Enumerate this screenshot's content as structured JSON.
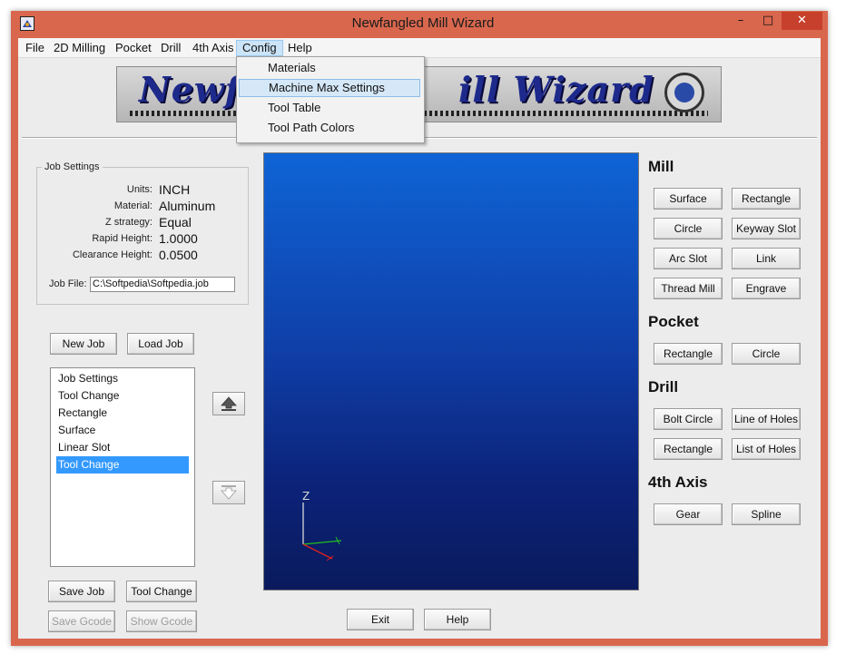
{
  "window": {
    "title": "Newfangled Mill Wizard",
    "minimize_label": "–",
    "maximize_label": "□",
    "close_label": "✕"
  },
  "menubar": {
    "items": [
      "File",
      "2D Milling",
      "Pocket",
      "Drill",
      "4th Axis",
      "Config",
      "Help"
    ],
    "active": "Config"
  },
  "config_menu": {
    "items": [
      "Materials",
      "Machine Max Settings",
      "Tool Table",
      "Tool Path Colors"
    ],
    "highlighted": "Machine Max Settings"
  },
  "banner": {
    "text_left": "Newf",
    "text_right": "ill Wizard"
  },
  "job_settings": {
    "legend": "Job Settings",
    "rows": [
      {
        "label": "Units:",
        "value": "INCH"
      },
      {
        "label": "Material:",
        "value": "Aluminum"
      },
      {
        "label": "Z strategy:",
        "value": "Equal"
      },
      {
        "label": "Rapid Height:",
        "value": "1.0000"
      },
      {
        "label": "Clearance Height:",
        "value": "0.0500"
      }
    ],
    "job_file_label": "Job File:",
    "job_file_value": "C:\\Softpedia\\Softpedia.job"
  },
  "job_buttons": {
    "new_job": "New Job",
    "load_job": "Load Job",
    "save_job": "Save Job",
    "tool_change": "Tool Change",
    "save_gcode": "Save Gcode",
    "show_gcode": "Show Gcode"
  },
  "operations": {
    "items": [
      "Job Settings",
      "Tool Change",
      "Rectangle",
      "Surface",
      "Linear Slot",
      "Tool Change"
    ],
    "selected_index": 5
  },
  "viewport": {
    "axis_label": "Z",
    "colors": {
      "x_axis": "#e02020",
      "y_axis": "#20c020",
      "z_axis": "#d8d8d8"
    }
  },
  "bottom_buttons": {
    "exit": "Exit",
    "help": "Help"
  },
  "palette": {
    "mill": {
      "title": "Mill",
      "buttons": [
        "Surface",
        "Rectangle",
        "Circle",
        "Keyway Slot",
        "Arc Slot",
        "Link",
        "Thread Mill",
        "Engrave"
      ]
    },
    "pocket": {
      "title": "Pocket",
      "buttons": [
        "Rectangle",
        "Circle"
      ]
    },
    "drill": {
      "title": "Drill",
      "buttons": [
        "Bolt Circle",
        "Line of Holes",
        "Rectangle",
        "List of Holes"
      ]
    },
    "fourth_axis": {
      "title": "4th Axis",
      "buttons": [
        "Gear",
        "Spline"
      ]
    }
  }
}
